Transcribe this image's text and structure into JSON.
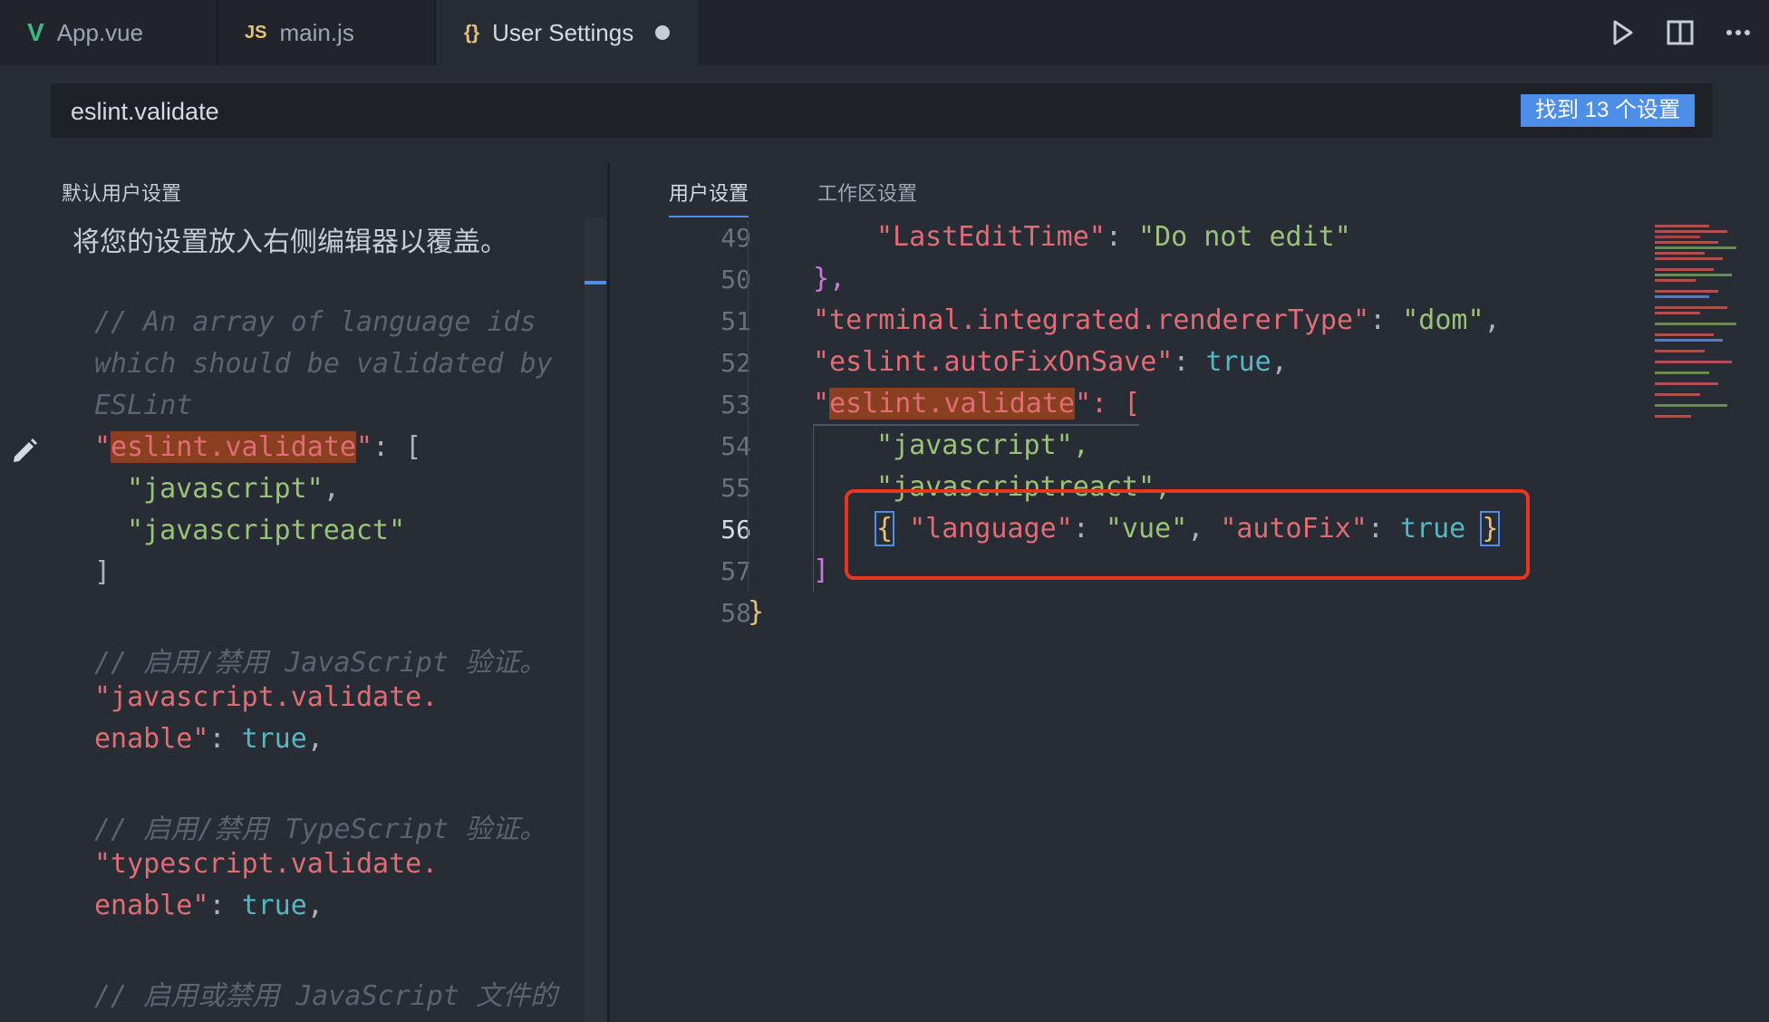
{
  "tabs": [
    {
      "icon": "V",
      "label": "App.vue",
      "icon_color": "#41b883"
    },
    {
      "icon": "JS",
      "label": "main.js",
      "icon_color": "#e5c07b"
    },
    {
      "icon": "{}",
      "label": "User Settings",
      "icon_color": "#e5c07b",
      "active": true,
      "modified": true
    }
  ],
  "toolbar": {
    "run_icon": "play-icon",
    "split_icon": "split-editor-icon",
    "more_icon": "more-icon"
  },
  "search": {
    "value": "eslint.validate",
    "result_badge": "找到 13 个设置"
  },
  "left_panel": {
    "title": "默认用户设置",
    "description": "将您的设置放入右侧编辑器以覆盖。",
    "code": {
      "c1": "// An array of language ids",
      "c2": "which should be validated by",
      "c3": "ESLint",
      "k1_q1": "\"",
      "k1": "eslint.validate",
      "k1_q2": "\"",
      "k1_rest": ": [",
      "v1": "\"javascript\"",
      "v1_comma": ",",
      "v2": "\"javascriptreact\"",
      "close": "]",
      "c4": "// 启用/禁用 JavaScript 验证。",
      "k2a": "\"javascript.validate.",
      "k2b": "enable\"",
      "colon": ": ",
      "true": "true",
      "comma": ",",
      "c5": "// 启用/禁用 TypeScript 验证。",
      "k3a": "\"typescript.validate.",
      "k3b": "enable\"",
      "c6": "// 启用或禁用 JavaScript 文件的"
    }
  },
  "right_panel": {
    "tabs": [
      "用户设置",
      "工作区设置"
    ],
    "line_numbers": [
      "49",
      "50",
      "51",
      "52",
      "53",
      "54",
      "55",
      "56",
      "57",
      "58"
    ],
    "current_line": "56",
    "code": {
      "l49_k": "\"LastEditTime\"",
      "l49_v": "\"Do not edit\"",
      "l50": "},",
      "l51_k": "\"terminal.integrated.rendererType\"",
      "l51_v": "\"dom\"",
      "l52_k": "\"eslint.autoFixOnSave\"",
      "l52_v": "true",
      "l53_q": "\"",
      "l53_k": "eslint.validate",
      "l53_rest": "\": [",
      "l54": "\"javascript\",",
      "l55": "\"javascriptreact\",",
      "l56_open": "{",
      "l56_k1": "\"language\"",
      "l56_v1": "\"vue\"",
      "l56_k2": "\"autoFix\"",
      "l56_v2": "true",
      "l56_close": "}",
      "l57": "]",
      "l58": "}"
    }
  },
  "colors": {
    "accent": "#4d8fe8",
    "highlight_box": "#e5361f",
    "search_match": "#8a3f20"
  }
}
